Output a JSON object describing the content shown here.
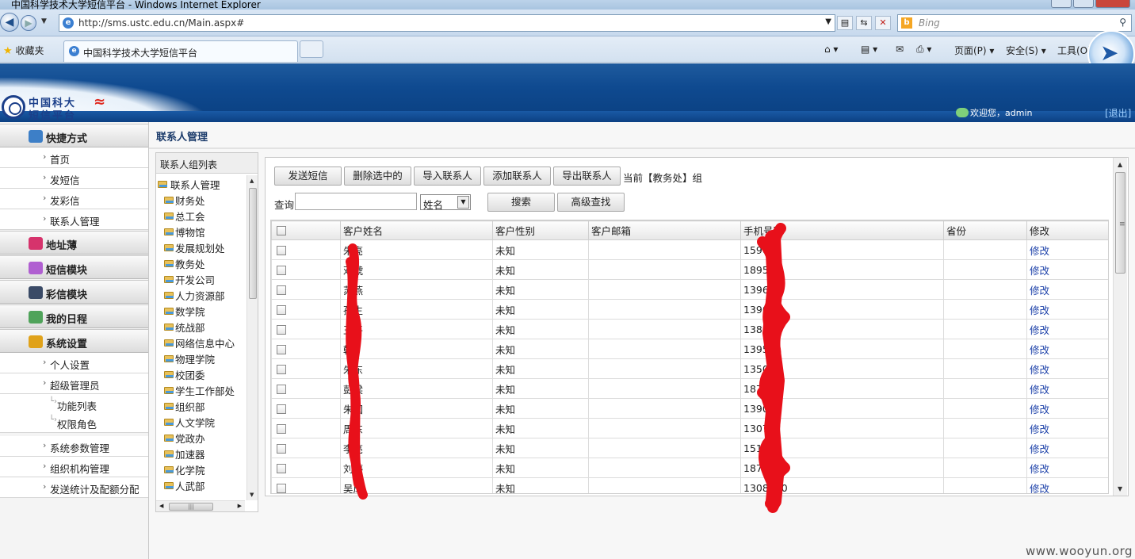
{
  "browser": {
    "window_title": "中国科学技术大学短信平台 - Windows Internet Explorer",
    "url": "http://sms.ustc.edu.cn/Main.aspx#",
    "search_placeholder": "Bing",
    "favorites_label": "收藏夹",
    "tab_title": "中国科学技术大学短信平台",
    "commands": {
      "page": "页面(P)",
      "safety": "安全(S)",
      "tools": "工具(O)"
    }
  },
  "header": {
    "logo_line1": "中国科大",
    "logo_line2": "短信平台",
    "welcome": "欢迎您，admin",
    "logout": "[退出]"
  },
  "sidebar": {
    "sections": [
      {
        "label": "快捷方式",
        "icon": "shortcut-icon"
      },
      {
        "label": "地址薄",
        "icon": "address-book-icon"
      },
      {
        "label": "短信模块",
        "icon": "sms-module-icon"
      },
      {
        "label": "彩信模块",
        "icon": "mms-module-icon"
      },
      {
        "label": "我的日程",
        "icon": "schedule-icon"
      },
      {
        "label": "系统设置",
        "icon": "settings-icon"
      }
    ],
    "shortcut_items": [
      "首页",
      "发短信",
      "发彩信",
      "联系人管理"
    ],
    "settings_items": [
      "个人设置",
      "超级管理员",
      "功能列表",
      "权限角色",
      "系统参数管理",
      "组织机构管理",
      "发送统计及配额分配"
    ]
  },
  "page": {
    "title": "联系人管理",
    "group_list_header": "联系人组列表",
    "tree_root": "联系人管理",
    "groups": [
      "财务处",
      "总工会",
      "博物馆",
      "发展规划处",
      "教务处",
      "开发公司",
      "人力资源部",
      "数学院",
      "统战部",
      "网络信息中心",
      "物理学院",
      "校团委",
      "学生工作部处",
      "组织部",
      "人文学院",
      "党政办",
      "加速器",
      "化学院",
      "人武部"
    ]
  },
  "toolbar": {
    "send_sms": "发送短信",
    "delete_selected": "删除选中的",
    "import_contacts": "导入联系人",
    "add_contact": "添加联系人",
    "export_contacts": "导出联系人",
    "current_group": "当前【教务处】组"
  },
  "search": {
    "label": "查询",
    "value": "",
    "field_selected": "姓名",
    "search_button": "搜索",
    "advanced_button": "高级查找"
  },
  "table": {
    "columns": [
      "客户姓名",
      "客户性别",
      "客户邮箱",
      "手机号码",
      "省份",
      "修改"
    ],
    "rows": [
      {
        "name": "朱亮",
        "gender": "未知",
        "email": "",
        "phone": "1590",
        "province": "",
        "edit": "修改"
      },
      {
        "name": "邓虓",
        "gender": "未知",
        "email": "",
        "phone": "1895",
        "province": "",
        "edit": "修改"
      },
      {
        "name": "苏燕",
        "gender": "未知",
        "email": "",
        "phone": "1396",
        "province": "",
        "edit": "修改"
      },
      {
        "name": "孙生",
        "gender": "未知",
        "email": "",
        "phone": "1390",
        "province": "",
        "edit": "修改"
      },
      {
        "name": "王平",
        "gender": "未知",
        "email": "",
        "phone": "1380",
        "province": "",
        "edit": "修改"
      },
      {
        "name": "韩",
        "gender": "未知",
        "email": "",
        "phone": "1395",
        "province": "",
        "edit": "修改"
      },
      {
        "name": "朱东",
        "gender": "未知",
        "email": "",
        "phone": "1350",
        "province": "",
        "edit": "修改"
      },
      {
        "name": "彭梁",
        "gender": "未知",
        "email": "",
        "phone": "1875",
        "province": "",
        "edit": "修改"
      },
      {
        "name": "朱国",
        "gender": "未知",
        "email": "",
        "phone": "1390",
        "province": "",
        "edit": "修改"
      },
      {
        "name": "周东",
        "gender": "未知",
        "email": "",
        "phone": "1307",
        "province": "",
        "edit": "修改"
      },
      {
        "name": "李亮",
        "gender": "未知",
        "email": "",
        "phone": "1510",
        "province": "",
        "edit": "修改"
      },
      {
        "name": "刘婷",
        "gender": "未知",
        "email": "",
        "phone": "1875",
        "province": "",
        "edit": "修改"
      },
      {
        "name": "吴成",
        "gender": "未知",
        "email": "",
        "phone": "1308390",
        "province": "",
        "edit": "修改"
      }
    ]
  },
  "watermark": "www.wooyun.org",
  "colors": {
    "header_blue": "#0f4a90",
    "link_blue": "#1a3fa8",
    "scribble_red": "#e8101a"
  }
}
